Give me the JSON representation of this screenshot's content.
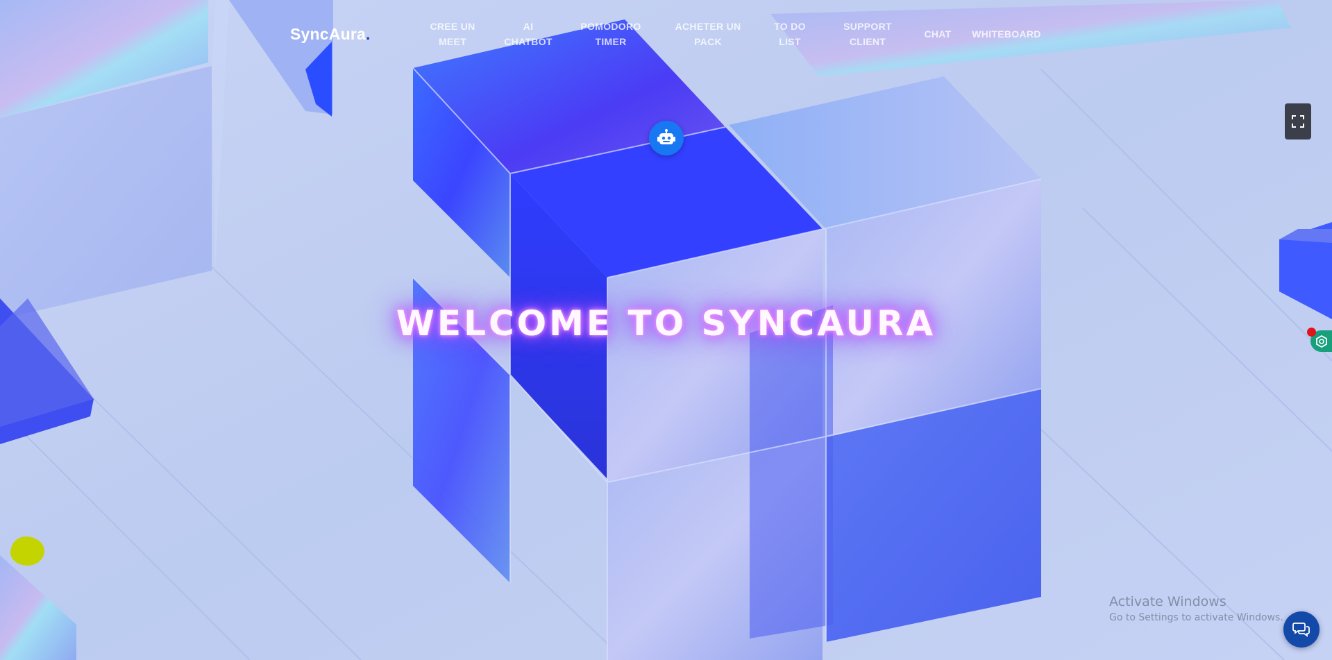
{
  "brand": {
    "name": "SyncAura",
    "dot": "."
  },
  "nav": {
    "items": [
      {
        "label_line1": "CREE UN",
        "label_line2": "MEET"
      },
      {
        "label_line1": "AI",
        "label_line2": "CHATBOT"
      },
      {
        "label_line1": "POMODORO",
        "label_line2": "TIMER"
      },
      {
        "label_line1": "ACHETER UN",
        "label_line2": "PACK"
      },
      {
        "label_line1": "TO DO",
        "label_line2": "LIST"
      },
      {
        "label_line1": "SUPPORT",
        "label_line2": "CLIENT"
      },
      {
        "label_line1": "CHAT",
        "label_line2": ""
      },
      {
        "label_line1": "WHITEBOARD",
        "label_line2": ""
      }
    ]
  },
  "hero": {
    "title": "WELCOME TO SYNCAURA"
  },
  "windows_watermark": {
    "title": "Activate Windows",
    "subtitle": "Go to Settings to activate Windows."
  },
  "icons": {
    "robot": "robot-icon",
    "fullscreen": "fullscreen-icon",
    "extension": "hexagon-icon",
    "chat": "chat-icon"
  },
  "colors": {
    "background": "#c3d0f2",
    "cube_blue": "#2f45ff",
    "robot_button": "#1877f2",
    "chat_button": "#1349a8",
    "glow": "#a24dff",
    "extension_badge": "#18a07c"
  }
}
